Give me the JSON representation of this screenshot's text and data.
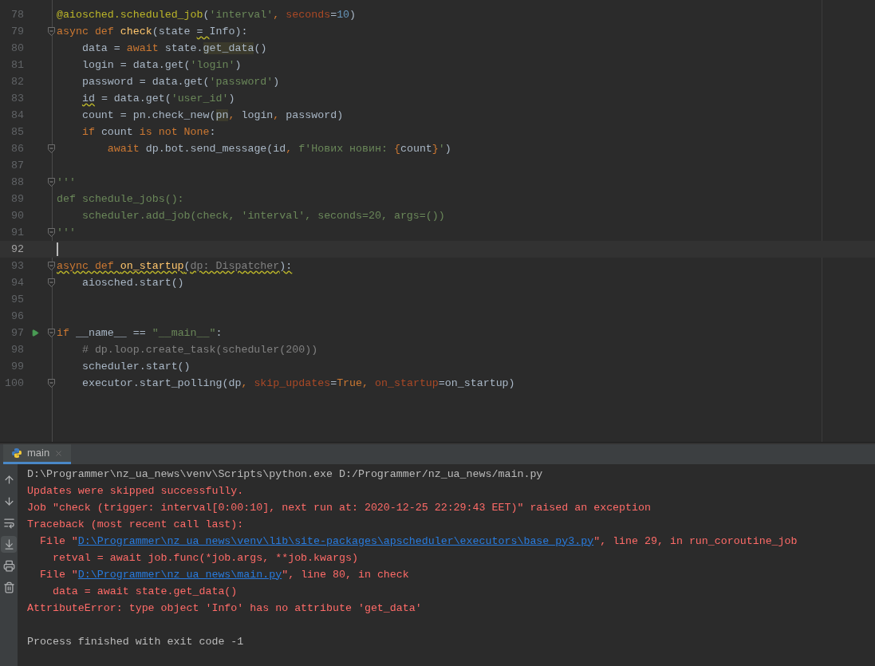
{
  "editor": {
    "lines": [
      {
        "number": "78",
        "tokens": [
          {
            "text": "@aiosched.scheduled_job",
            "kind": "decorator"
          },
          {
            "text": "(",
            "kind": "plain"
          },
          {
            "text": "'interval'",
            "kind": "string"
          },
          {
            "text": ", ",
            "kind": "punct"
          },
          {
            "text": "seconds",
            "kind": "kwarg"
          },
          {
            "text": "=",
            "kind": "plain"
          },
          {
            "text": "10",
            "kind": "number"
          },
          {
            "text": ")",
            "kind": "plain"
          }
        ]
      },
      {
        "number": "79",
        "fold": true,
        "tokens": [
          {
            "text": "async def ",
            "kind": "keyword"
          },
          {
            "text": "check",
            "kind": "funcname"
          },
          {
            "text": "(state",
            "kind": "plain"
          },
          {
            "text": " = ",
            "kind": "plain",
            "warning": true
          },
          {
            "text": "Info):",
            "kind": "plain"
          }
        ]
      },
      {
        "number": "80",
        "tokens": [
          {
            "text": "    data = ",
            "kind": "plain"
          },
          {
            "text": "await ",
            "kind": "keyword"
          },
          {
            "text": "state.",
            "kind": "plain"
          },
          {
            "text": "get_data",
            "kind": "highlight"
          },
          {
            "text": "()",
            "kind": "plain"
          }
        ]
      },
      {
        "number": "81",
        "tokens": [
          {
            "text": "    login = data.get(",
            "kind": "plain"
          },
          {
            "text": "'login'",
            "kind": "string"
          },
          {
            "text": ")",
            "kind": "plain"
          }
        ]
      },
      {
        "number": "82",
        "tokens": [
          {
            "text": "    password = data.get(",
            "kind": "plain"
          },
          {
            "text": "'password'",
            "kind": "string"
          },
          {
            "text": ")",
            "kind": "plain"
          }
        ]
      },
      {
        "number": "83",
        "tokens": [
          {
            "text": "    id",
            "kind": "plain",
            "warning": true
          },
          {
            "text": " = data.get(",
            "kind": "plain"
          },
          {
            "text": "'user_id'",
            "kind": "string"
          },
          {
            "text": ")",
            "kind": "plain"
          }
        ]
      },
      {
        "number": "84",
        "tokens": [
          {
            "text": "    count = pn.check_new(",
            "kind": "plain"
          },
          {
            "text": "pn",
            "kind": "highlight"
          },
          {
            "text": ", ",
            "kind": "punct"
          },
          {
            "text": "login",
            "kind": "plain"
          },
          {
            "text": ", ",
            "kind": "punct"
          },
          {
            "text": "password)",
            "kind": "plain"
          }
        ]
      },
      {
        "number": "85",
        "tokens": [
          {
            "text": "    if ",
            "kind": "keyword"
          },
          {
            "text": "count ",
            "kind": "plain"
          },
          {
            "text": "is not None",
            "kind": "keyword"
          },
          {
            "text": ":",
            "kind": "plain"
          }
        ]
      },
      {
        "number": "86",
        "fold": true,
        "tokens": [
          {
            "text": "        await ",
            "kind": "keyword"
          },
          {
            "text": "dp.bot.send_message(id",
            "kind": "plain"
          },
          {
            "text": ", ",
            "kind": "punct"
          },
          {
            "text": "f'Нових новин: ",
            "kind": "string"
          },
          {
            "text": "{",
            "kind": "punct"
          },
          {
            "text": "count",
            "kind": "plain"
          },
          {
            "text": "}",
            "kind": "punct"
          },
          {
            "text": "'",
            "kind": "string"
          },
          {
            "text": ")",
            "kind": "plain"
          }
        ]
      },
      {
        "number": "87"
      },
      {
        "number": "88",
        "fold": true,
        "tokens": [
          {
            "text": "'''",
            "kind": "string"
          }
        ]
      },
      {
        "number": "89",
        "tokens": [
          {
            "text": "def schedule_jobs():",
            "kind": "string"
          }
        ]
      },
      {
        "number": "90",
        "tokens": [
          {
            "text": "    scheduler.add_job(check, 'interval', seconds=20, args=())",
            "kind": "string"
          }
        ]
      },
      {
        "number": "91",
        "fold": true,
        "tokens": [
          {
            "text": "'''",
            "kind": "string"
          }
        ]
      },
      {
        "number": "92",
        "current": true
      },
      {
        "number": "93",
        "fold": true,
        "tokens": [
          {
            "text": "async def ",
            "kind": "keyword",
            "warning": true
          },
          {
            "text": "on_startup",
            "kind": "funcname",
            "warning": true
          },
          {
            "text": "(",
            "kind": "plain",
            "warning": true
          },
          {
            "text": "dp: Dispatcher",
            "kind": "comment",
            "warning": true
          },
          {
            "text": "):",
            "kind": "plain",
            "warning": true
          }
        ]
      },
      {
        "number": "94",
        "fold": true,
        "tokens": [
          {
            "text": "    aiosched.start()",
            "kind": "plain"
          }
        ]
      },
      {
        "number": "95"
      },
      {
        "number": "96"
      },
      {
        "number": "97",
        "fold": true,
        "run": true,
        "tokens": [
          {
            "text": "if ",
            "kind": "keyword"
          },
          {
            "text": "__name__ == ",
            "kind": "plain"
          },
          {
            "text": "\"__main__\"",
            "kind": "string"
          },
          {
            "text": ":",
            "kind": "plain"
          }
        ]
      },
      {
        "number": "98",
        "tokens": [
          {
            "text": "    # dp.loop.create_task(scheduler(200))",
            "kind": "comment"
          }
        ]
      },
      {
        "number": "99",
        "tokens": [
          {
            "text": "    scheduler.start()",
            "kind": "plain"
          }
        ]
      },
      {
        "number": "100",
        "fold": true,
        "tokens": [
          {
            "text": "    executor.start_polling(dp",
            "kind": "plain"
          },
          {
            "text": ", ",
            "kind": "punct"
          },
          {
            "text": "skip_updates",
            "kind": "kwarg"
          },
          {
            "text": "=",
            "kind": "plain"
          },
          {
            "text": "True",
            "kind": "keyword"
          },
          {
            "text": ", ",
            "kind": "punct"
          },
          {
            "text": "on_startup",
            "kind": "kwarg"
          },
          {
            "text": "=on_startup)",
            "kind": "plain"
          }
        ]
      }
    ]
  },
  "run_panel": {
    "tabs": [
      {
        "label": "main",
        "selected": true
      }
    ],
    "toolbar": [
      {
        "kind": "up",
        "on": false
      },
      {
        "kind": "down",
        "on": false
      },
      {
        "kind": "wrap",
        "on": false
      },
      {
        "kind": "scroll-end",
        "on": true
      },
      {
        "kind": "print",
        "on": false
      },
      {
        "kind": "trash",
        "on": false
      }
    ],
    "lines": [
      {
        "segments": [
          {
            "text": "D:\\Programmer\\nz_ua_news\\venv\\Scripts\\python.exe D:/Programmer/nz_ua_news/main.py",
            "kind": "plain"
          }
        ]
      },
      {
        "segments": [
          {
            "text": "Updates were skipped successfully.",
            "kind": "error"
          }
        ]
      },
      {
        "segments": [
          {
            "text": "Job \"check (trigger: interval[0:00:10], next run at: 2020-12-25 22:29:43 EET)\" raised an exception",
            "kind": "error"
          }
        ]
      },
      {
        "segments": [
          {
            "text": "Traceback (most recent call last):",
            "kind": "error"
          }
        ]
      },
      {
        "segments": [
          {
            "text": "  File \"",
            "kind": "error"
          },
          {
            "text": "D:\\Programmer\\nz_ua_news\\venv\\lib\\site-packages\\apscheduler\\executors\\base_py3.py",
            "kind": "link"
          },
          {
            "text": "\", line 29, in run_coroutine_job",
            "kind": "error"
          }
        ]
      },
      {
        "segments": [
          {
            "text": "    retval = await job.func(*job.args, **job.kwargs)",
            "kind": "error"
          }
        ]
      },
      {
        "segments": [
          {
            "text": "  File \"",
            "kind": "error"
          },
          {
            "text": "D:\\Programmer\\nz_ua_news\\main.py",
            "kind": "link"
          },
          {
            "text": "\", line 80, in check",
            "kind": "error"
          }
        ]
      },
      {
        "segments": [
          {
            "text": "    data = await state.get_data()",
            "kind": "error"
          }
        ]
      },
      {
        "segments": [
          {
            "text": "AttributeError: type object 'Info' has no attribute 'get_data'",
            "kind": "error"
          }
        ]
      },
      {
        "blank_before": true,
        "segments": [
          {
            "text": "Process finished with exit code -1",
            "kind": "plain"
          }
        ]
      }
    ]
  }
}
